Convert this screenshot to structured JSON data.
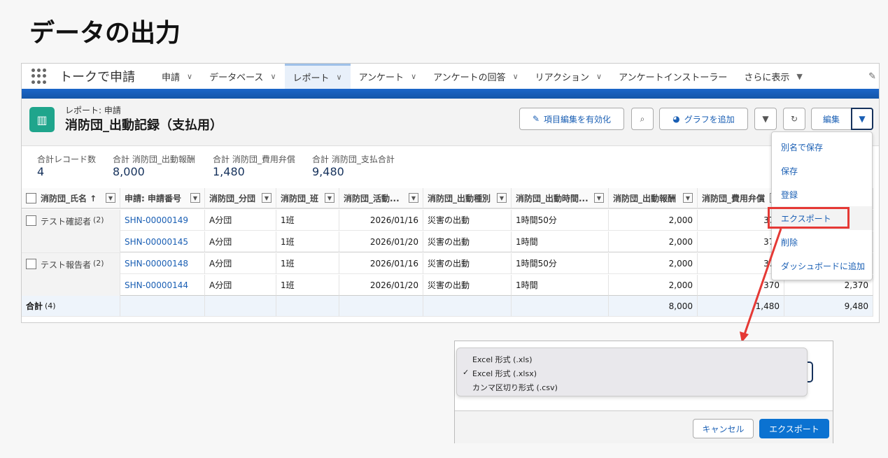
{
  "page_title": "データの出力",
  "nav": {
    "app": "トークで申請",
    "tabs": [
      {
        "label": "申請"
      },
      {
        "label": "データベース"
      },
      {
        "label": "レポート",
        "active": true
      },
      {
        "label": "アンケート"
      },
      {
        "label": "アンケートの回答"
      },
      {
        "label": "リアクション"
      },
      {
        "label": "アンケートインストーラー",
        "no_chevron": true
      },
      {
        "label": "さらに表示",
        "caret": true
      }
    ]
  },
  "report": {
    "subtitle": "レポート: 申請",
    "title": "消防団_出動記録（支払用）"
  },
  "buttons": {
    "inline_edit": "項目編集を有効化",
    "add_chart": "グラフを追加",
    "edit": "編集"
  },
  "summary": [
    {
      "label": "合計レコード数",
      "value": "4"
    },
    {
      "label": "合計 消防団_出動報酬",
      "value": "8,000"
    },
    {
      "label": "合計 消防団_費用弁償",
      "value": "1,480"
    },
    {
      "label": "合計 消防団_支払合計",
      "value": "9,480"
    }
  ],
  "table": {
    "headers": [
      "消防団_氏名 ↑",
      "申請: 申請番号",
      "消防団_分団",
      "消防団_班",
      "消防団_活動...",
      "消防団_出動種別",
      "消防団_出動時間...",
      "消防団_出動報酬",
      "消防団_費用弁償",
      ""
    ],
    "groups": [
      {
        "name": "テスト確認者",
        "count": "(2)"
      },
      {
        "name": "テスト報告者",
        "count": "(2)"
      }
    ],
    "rows": [
      [
        "SHN-00000149",
        "A分団",
        "1班",
        "2026/01/16",
        "災害の出動",
        "1時間50分",
        "2,000",
        "370",
        ""
      ],
      [
        "SHN-00000145",
        "A分団",
        "1班",
        "2026/01/20",
        "災害の出動",
        "1時間",
        "2,000",
        "370",
        ""
      ],
      [
        "SHN-00000148",
        "A分団",
        "1班",
        "2026/01/16",
        "災害の出動",
        "1時間50分",
        "2,000",
        "370",
        ""
      ],
      [
        "SHN-00000144",
        "A分団",
        "1班",
        "2026/01/20",
        "災害の出動",
        "1時間",
        "2,000",
        "370",
        "2,370"
      ]
    ],
    "total": {
      "label": "合計",
      "count": "(4)",
      "values": [
        "",
        "",
        "",
        "",
        "",
        "",
        "8,000",
        "1,480",
        "9,480"
      ]
    }
  },
  "menu": {
    "items": [
      "別名で保存",
      "保存",
      "登録",
      "エクスポート",
      "削除",
      "ダッシュボードに追加"
    ],
    "highlighted": "エクスポート"
  },
  "export_dialog": {
    "options": [
      {
        "label": "Excel 形式 (.xls)",
        "checked": false
      },
      {
        "label": "Excel 形式 (.xlsx)",
        "checked": true
      },
      {
        "label": "カンマ区切り形式 (.csv)",
        "checked": false
      }
    ],
    "check": "✓",
    "cancel": "キャンセル",
    "export": "エクスポート"
  },
  "colors": {
    "accent": "#0b72d1",
    "highlight": "#e53935",
    "report_icon": "#1fa58c"
  }
}
